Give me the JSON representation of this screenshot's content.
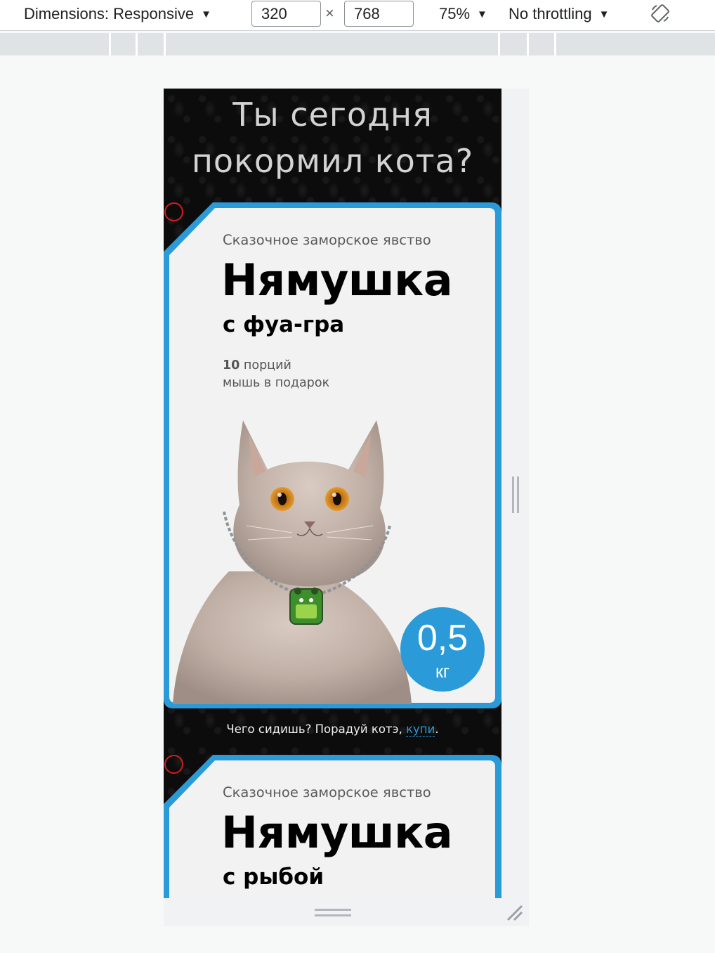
{
  "toolbar": {
    "dimensions_label": "Dimensions: Responsive",
    "width_value": "320",
    "times": "×",
    "height_value": "768",
    "zoom": "75%",
    "throttling": "No throttling",
    "caret": "▼",
    "rotate_icon": "rotate-device-icon"
  },
  "page": {
    "headline_line1": "Ты сегодня",
    "headline_line2": "покормил кота?",
    "accent_color": "#2a9ad8",
    "cards": [
      {
        "tagline": "Сказочное заморское явство",
        "name": "Нямушка",
        "flavor": "с фуа-гра",
        "portions_count": "10",
        "portions_label": " порций",
        "gift": "мышь в подарок",
        "weight_value": "0,5",
        "weight_unit": "кг"
      },
      {
        "tagline": "Сказочное заморское явство",
        "name": "Нямушка",
        "flavor": "с рыбой"
      }
    ],
    "cta_text": "Чего сидишь? Порадуй котэ, ",
    "cta_link": "купи",
    "cta_end": "."
  }
}
